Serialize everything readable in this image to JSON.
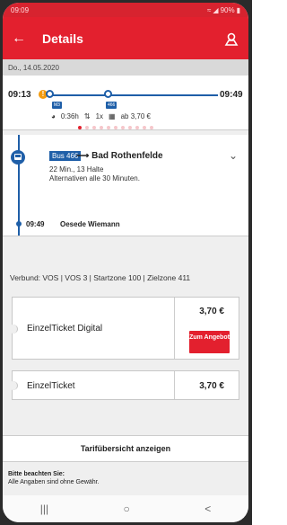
{
  "status": {
    "time": "09:09",
    "battery": "90%"
  },
  "header": {
    "title": "Details"
  },
  "date": "Do., 14.05.2020",
  "trip": {
    "depart_time": "09:13",
    "arrive_time": "09:49",
    "badge1": "M3",
    "badge2": "466",
    "duration": "0:36h",
    "transfers": "1x",
    "price_from": "ab 3,70 €",
    "page_dots_count": 11,
    "active_dot": 0
  },
  "segment": {
    "bus_label": "Bus 466",
    "destination": "Bad Rothenfelde",
    "details_line1": "22 Min., 13 Halte",
    "details_line2": "Alternativen alle 30 Minuten.",
    "stop_time": "09:49",
    "stop_name": "Oesede Wiemann"
  },
  "tickets": {
    "verbund": "Verbund: VOS | VOS 3 | Startzone 100 | Zielzone 411",
    "items": [
      {
        "name": "EinzelTicket Digital",
        "price": "3,70 €",
        "button": "Zum Angebot"
      },
      {
        "name": "EinzelTicket",
        "price": "3,70 €"
      }
    ]
  },
  "tarif_link": "Tarifübersicht anzeigen",
  "notice": {
    "title": "Bitte beachten Sie:",
    "text": "Alle Angaben sind ohne Gewähr."
  },
  "nav": {
    "recent": "|||",
    "home": "○",
    "back": "<"
  },
  "colors": {
    "primary": "#e3202e",
    "transit": "#1f5fa8",
    "warning": "#f39b0e"
  }
}
